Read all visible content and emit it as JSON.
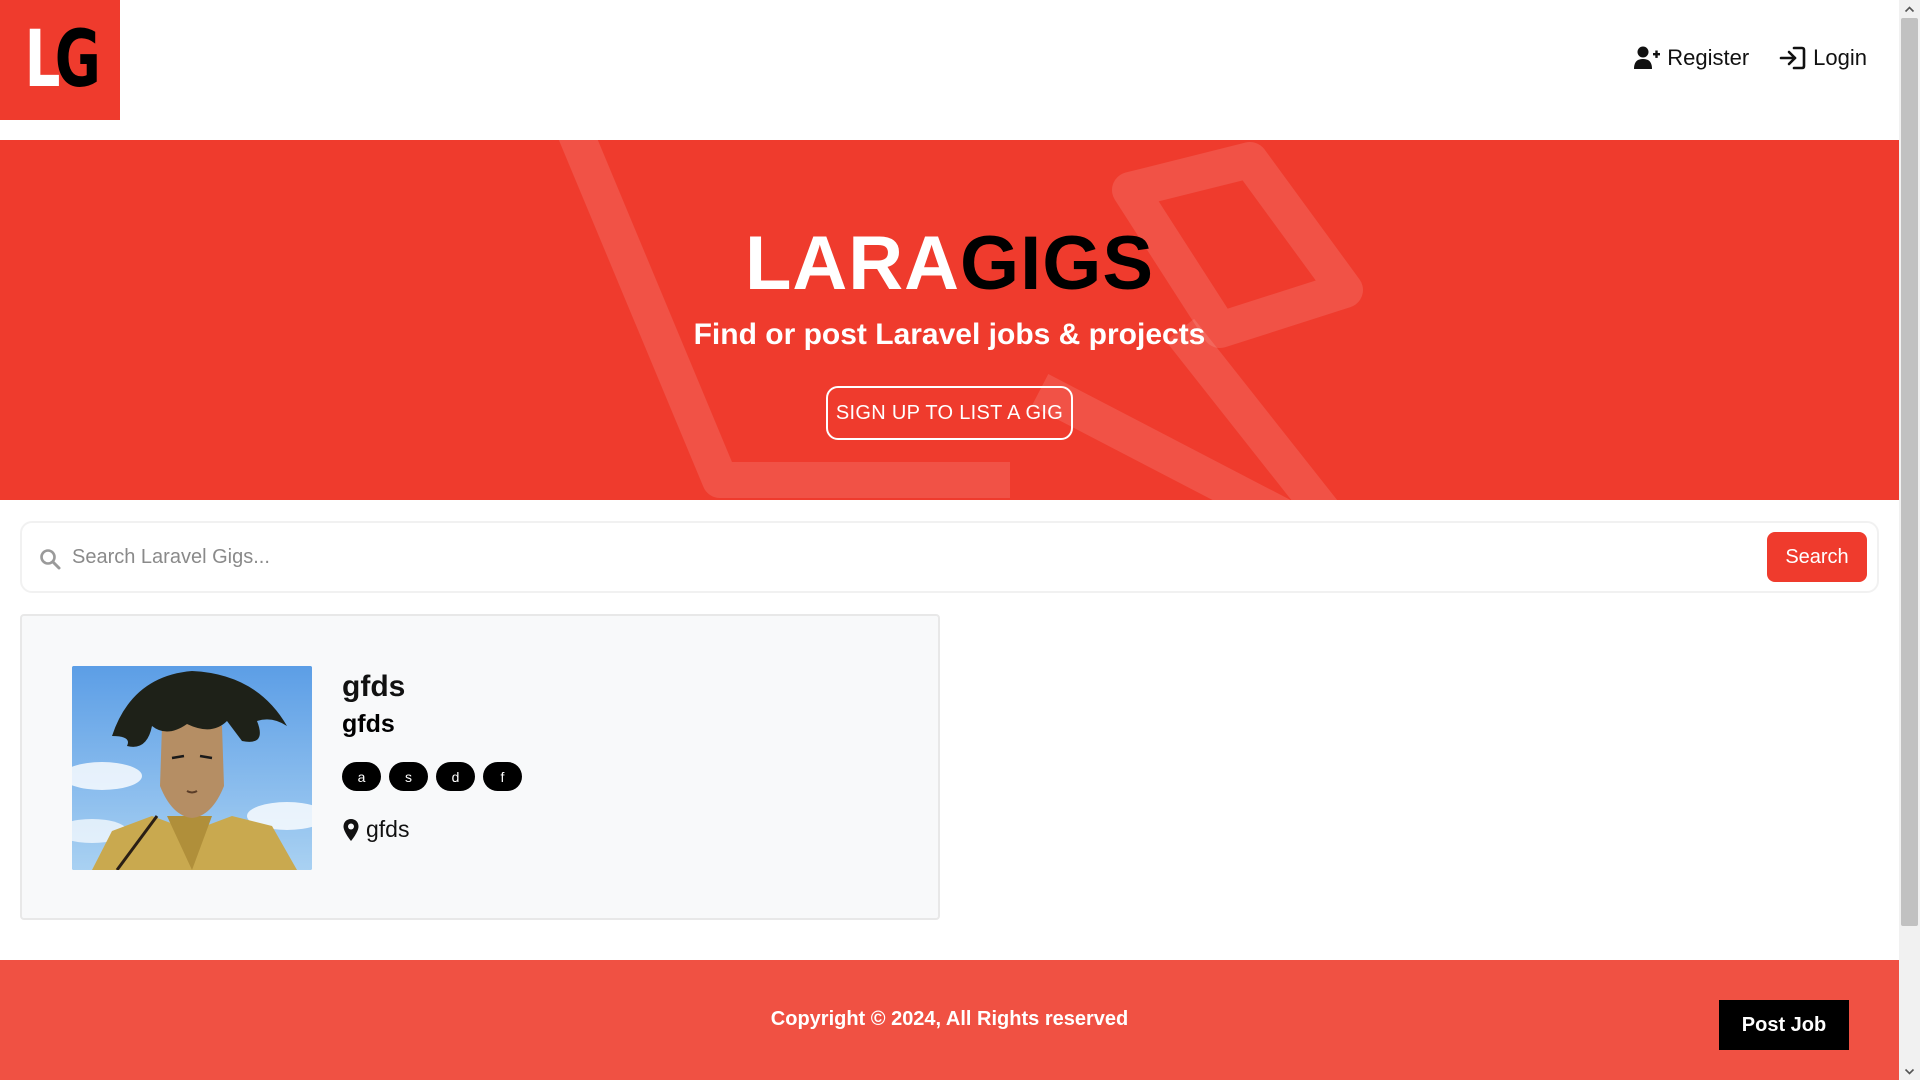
{
  "nav": {
    "logo": {
      "letter_1": "L",
      "letter_2": "G"
    },
    "register_label": "Register",
    "login_label": "Login"
  },
  "hero": {
    "title_light": "LARA",
    "title_dark": "GIGS",
    "subtitle": "Find or post Laravel jobs & projects",
    "cta_label": "SIGN UP TO LIST A GIG"
  },
  "search": {
    "placeholder": "Search Laravel Gigs...",
    "value": "",
    "button_label": "Search"
  },
  "listings": [
    {
      "title": "gfds",
      "company": "gfds",
      "tags": [
        "a",
        "s",
        "d",
        "f"
      ],
      "location": "gfds"
    }
  ],
  "footer": {
    "copyright": "Copyright © 2024, All Rights reserved",
    "post_job_label": "Post Job"
  },
  "colors": {
    "brand_red": "#ef3b2d",
    "footer_red": "#f05143",
    "black": "#000000",
    "card_bg": "#f8f9fa"
  },
  "icons": {
    "register": "user-plus-icon",
    "login": "sign-in-icon",
    "search": "search-icon",
    "location": "location-pin-icon"
  }
}
